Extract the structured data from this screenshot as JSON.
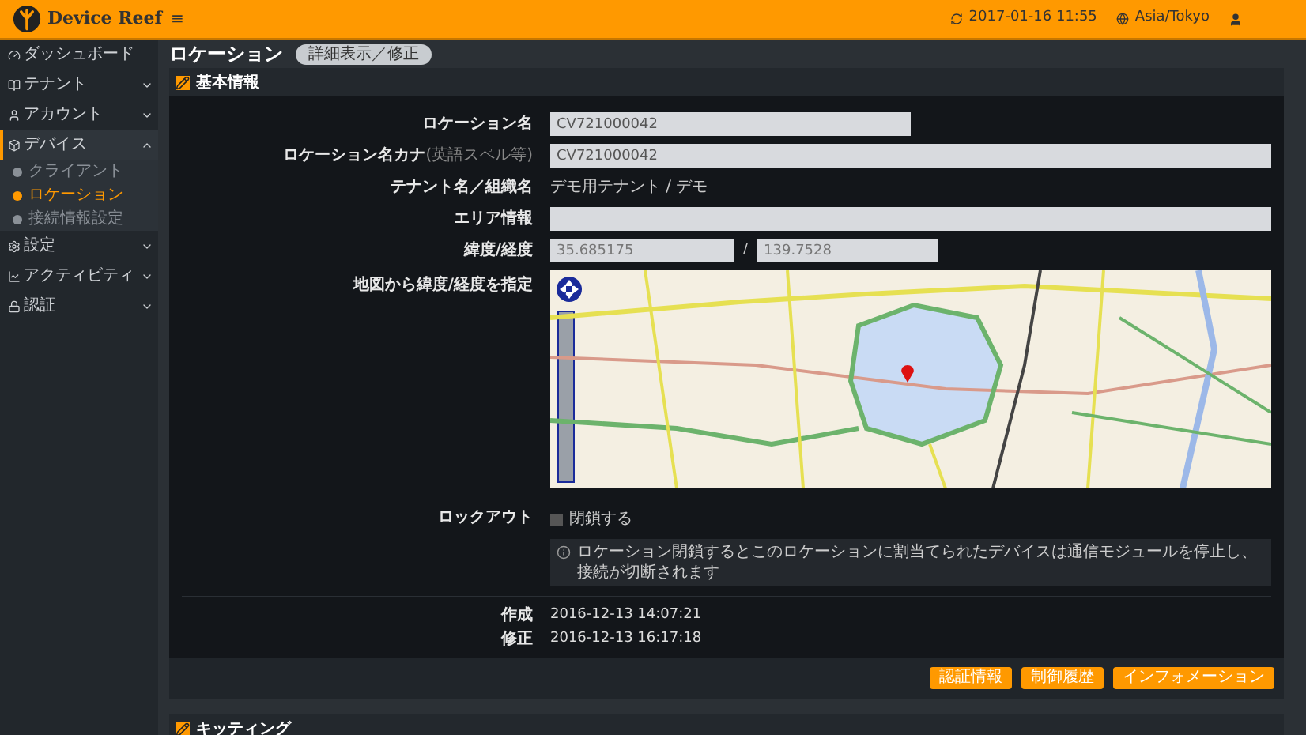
{
  "header": {
    "brand": "Device Reef",
    "menu_glyph": "≡",
    "datetime": "2017-01-16 11:55",
    "timezone": "Asia/Tokyo"
  },
  "sidebar": {
    "items": [
      {
        "label": "ダッシュボード",
        "selected": false
      },
      {
        "label": "テナント",
        "selected": false,
        "expanded": false
      },
      {
        "label": "アカウント",
        "selected": false,
        "expanded": false
      },
      {
        "label": "デバイス",
        "selected": true,
        "expanded": true,
        "children": [
          {
            "label": "クライアント",
            "selected": false
          },
          {
            "label": "ロケーション",
            "selected": true
          },
          {
            "label": "接続情報設定",
            "selected": false
          }
        ]
      },
      {
        "label": "設定",
        "selected": false,
        "expanded": false
      },
      {
        "label": "アクティビティ",
        "selected": false,
        "expanded": false
      },
      {
        "label": "認証",
        "selected": false,
        "expanded": false
      }
    ]
  },
  "page": {
    "title": "ロケーション",
    "badge": "詳細表示／修正"
  },
  "panel": {
    "title": "基本情報",
    "rows": [
      {
        "kind": "short-input",
        "label": "ロケーション名",
        "value": "CV721000042"
      },
      {
        "kind": "input",
        "label": "ロケーション名カナ",
        "sublabel": "(英語スペル等)",
        "value": "CV721000042"
      },
      {
        "kind": "text",
        "label": "テナント名／組織名",
        "value": "デモ用テナント / デモ"
      },
      {
        "kind": "input",
        "label": "エリア情報"
      },
      {
        "kind": "latlng",
        "label": "緯度/経度",
        "lat": "35.685175",
        "separator": "/",
        "lng": "139.7528"
      },
      {
        "kind": "map",
        "label": "地図から緯度/経度を指定"
      },
      {
        "kind": "checkbox",
        "label": "ロックアウト",
        "option": "閉鎖する",
        "checked": false,
        "note": "ロケーション閉鎖するとこのロケーションに割当てられたデバイスは通信モジュールを停止し、接続が切断されます"
      }
    ],
    "meta": [
      {
        "label": "作成",
        "value": "2016-12-13 14:07:21"
      },
      {
        "label": "修正",
        "value": "2016-12-13 16:17:18"
      }
    ],
    "buttons": [
      "認証情報",
      "制御履歴",
      "インフォメーション"
    ]
  },
  "panel2": {
    "title": "キッティング"
  }
}
